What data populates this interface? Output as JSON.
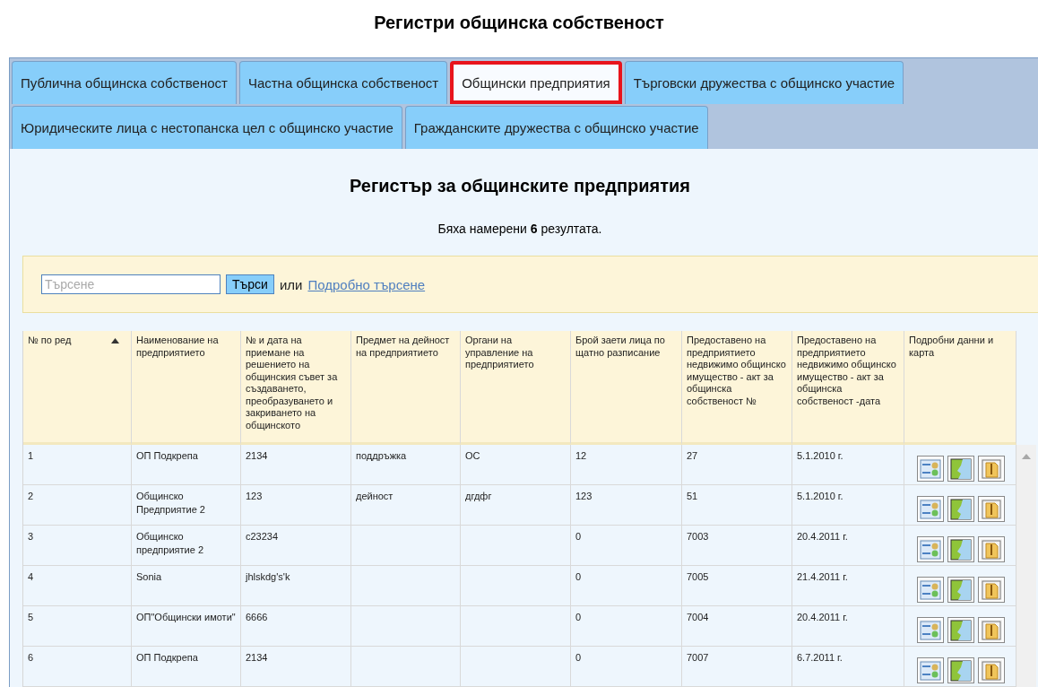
{
  "page_title": "Регистри общинска собственост",
  "tabs": [
    {
      "label": "Публична общинска собственост",
      "selected": false
    },
    {
      "label": "Частна общинска собственост",
      "selected": false
    },
    {
      "label": "Общински предприятия",
      "selected": true
    },
    {
      "label": "Търговски дружества с общинско участие",
      "selected": false
    },
    {
      "label": "Юридическите лица с нестопанска цел с общинско участие",
      "selected": false
    },
    {
      "label": "Гражданските дружества с общинско участие",
      "selected": false
    }
  ],
  "register": {
    "title": "Регистър за общинските предприятия",
    "result_text": "Бяха намерени **6** резултата."
  },
  "search": {
    "placeholder": "Търсене",
    "button": "Търси",
    "separator": "или",
    "advanced_link": "Подробно търсене"
  },
  "table": {
    "columns": [
      {
        "label": "№ по ред",
        "sorted": true
      },
      {
        "label": "Наименование на предприятието",
        "sorted": false
      },
      {
        "label": "№ и дата на приемане на решението на общинския съвет за създаването, преобразуването и закриването на общинското",
        "sorted": false
      },
      {
        "label": "Предмет на дейност на предприятието",
        "sorted": false
      },
      {
        "label": "Органи на управление на предприятието",
        "sorted": false
      },
      {
        "label": "Брой заети лица по щатно разписание",
        "sorted": false
      },
      {
        "label": "Предоставено на предприятието недвижимо общинско имущество - акт за общинска собственост №",
        "sorted": false
      },
      {
        "label": "Предоставено на предприятието недвижимо общинско имущество - акт за общинска собственост -дата",
        "sorted": false
      },
      {
        "label": "Подробни данни и карта",
        "sorted": false
      }
    ],
    "rows": [
      {
        "cells": [
          "1",
          "ОП Подкрепа",
          "2134",
          "поддръжка",
          "ОС",
          "12",
          "27",
          "5.1.2010 г."
        ]
      },
      {
        "cells": [
          "2",
          "Общинско Предприятие 2",
          "123",
          "дейност",
          "дгдфг",
          "123",
          "51",
          "5.1.2010 г."
        ]
      },
      {
        "cells": [
          "3",
          "Общинско предприятие 2",
          "c23234",
          "",
          "",
          "0",
          "7003",
          "20.4.2011 г."
        ]
      },
      {
        "cells": [
          "4",
          "Sonia",
          "jhlskdg's'k",
          "",
          "",
          "0",
          "7005",
          "21.4.2011 г."
        ]
      },
      {
        "cells": [
          "5",
          "ОП\"Общински имоти\"",
          "6666",
          "",
          "",
          "0",
          "7004",
          "20.4.2011 г."
        ]
      },
      {
        "cells": [
          "6",
          "ОП Подкрепа",
          "2134",
          "",
          "",
          "0",
          "7007",
          "6.7.2011 г."
        ]
      }
    ]
  }
}
